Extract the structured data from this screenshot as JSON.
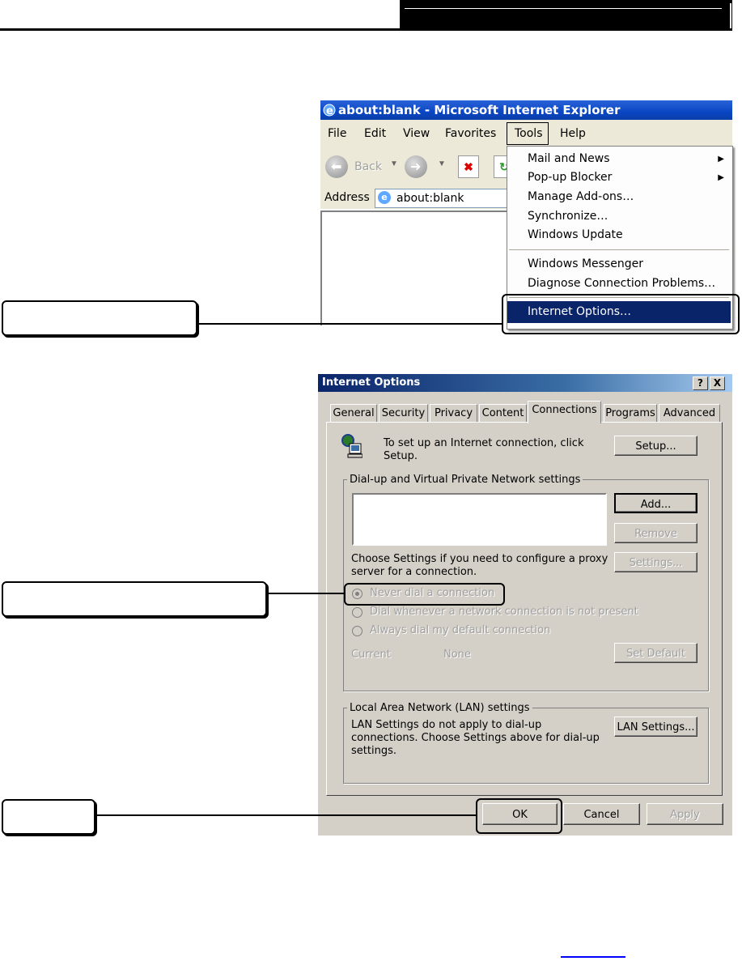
{
  "ie_window": {
    "title": "about:blank - Microsoft Internet Explorer",
    "menu": [
      "File",
      "Edit",
      "View",
      "Favorites",
      "Tools",
      "Help"
    ],
    "toolbar": {
      "back_label": "Back"
    },
    "address_label": "Address",
    "address_value": "about:blank"
  },
  "tools_menu": {
    "items": [
      {
        "label": "Mail and News",
        "submenu": true
      },
      {
        "label": "Pop-up Blocker",
        "submenu": true
      },
      {
        "label": "Manage Add-ons…",
        "submenu": false
      },
      {
        "label": "Synchronize…",
        "submenu": false
      },
      {
        "label": "Windows Update",
        "submenu": false
      },
      {
        "label": "Windows Messenger",
        "submenu": false
      },
      {
        "label": "Diagnose Connection Problems…",
        "submenu": false
      },
      {
        "label": "Internet Options…",
        "submenu": false,
        "selected": true
      }
    ]
  },
  "dialog": {
    "title": "Internet Options",
    "help_button": "?",
    "close_button": "X",
    "tabs": [
      "General",
      "Security",
      "Privacy",
      "Content",
      "Connections",
      "Programs",
      "Advanced"
    ],
    "active_tab": "Connections",
    "setup_text": "To set up an Internet connection, click Setup.",
    "setup_button": "Setup...",
    "dialup_group": "Dial-up and Virtual Private Network settings",
    "add_button": "Add...",
    "remove_button": "Remove",
    "proxy_text": "Choose Settings if you need to configure a proxy server for a connection.",
    "settings_button": "Settings...",
    "radios": [
      {
        "label": "Never dial a connection",
        "selected": true
      },
      {
        "label": "Dial whenever a network connection is not present",
        "selected": false
      },
      {
        "label": "Always dial my default connection",
        "selected": false
      }
    ],
    "current_label": "Current",
    "current_value": "None",
    "set_default_button": "Set Default",
    "lan_group": "Local Area Network (LAN) settings",
    "lan_text": "LAN Settings do not apply to dial-up connections. Choose Settings above for dial-up settings.",
    "lan_button": "LAN Settings...",
    "ok_button": "OK",
    "cancel_button": "Cancel",
    "apply_button": "Apply"
  },
  "colors": {
    "xp_title_blue": "#0a46c4",
    "menu_highlight": "#0a246a",
    "dialog_face": "#d4d0c8"
  }
}
